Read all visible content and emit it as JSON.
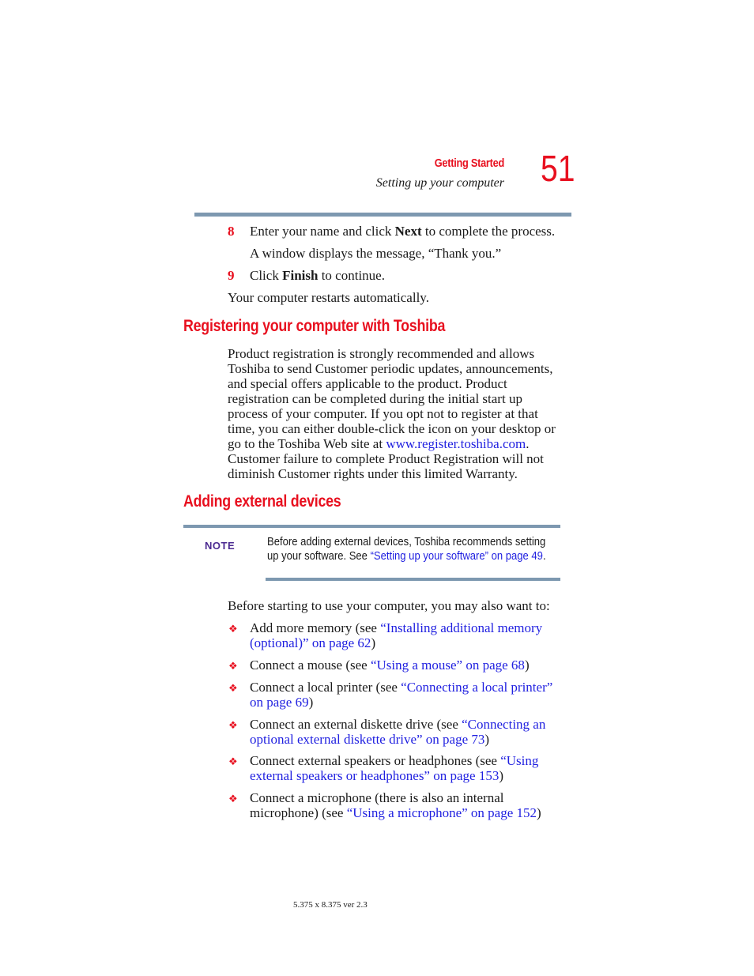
{
  "header": {
    "section": "Getting Started",
    "subsection": "Setting up your computer",
    "page_number": "51"
  },
  "steps": [
    {
      "number": "8",
      "before": "Enter your name and click ",
      "bold": "Next",
      "after": " to complete the process."
    },
    {
      "number": "",
      "text": "A window displays the message, “Thank you.”"
    },
    {
      "number": "9",
      "before": "Click ",
      "bold": "Finish",
      "after": " to continue."
    }
  ],
  "restart_text": "Your computer restarts automatically.",
  "registering": {
    "heading": "Registering your computer with Toshiba",
    "lines": [
      "Product registration is strongly recommended and allows",
      "Toshiba to send Customer periodic updates, announcements,",
      "and special offers applicable to the product. Product",
      "registration can be completed during the initial start up",
      "process of your computer. If you opt not to register at that",
      "time, you can either double-click the icon on your desktop or"
    ],
    "line7_before": "go to the Toshiba Web site at ",
    "link": "www.register.toshiba.com",
    "line7_after": ".",
    "lines_end": [
      "Customer failure to complete Product Registration will not",
      "diminish Customer rights under this limited Warranty."
    ]
  },
  "adding": {
    "heading": "Adding external devices",
    "note_label": "NOTE",
    "note_line1": "Before adding external devices, Toshiba recommends setting",
    "note_line2_before": "up your software. See ",
    "note_link": "“Setting up your software” on page 49",
    "note_line2_after": ".",
    "intro": "Before starting to use your computer, you may also want to:",
    "bullets": [
      {
        "l1_text": "Add more memory (see ",
        "l1_link": "“Installing additional memory",
        "l2_link": "(optional)” on page 62",
        "l2_text": ")"
      },
      {
        "l1_text": "Connect a mouse (see ",
        "l1_link": "“Using a mouse” on page 68",
        "l1_after": ")"
      },
      {
        "l1_text": "Connect a local printer (see ",
        "l1_link": "“Connecting a local printer”",
        "l2_link": "on page 69",
        "l2_text": ")"
      },
      {
        "l1_text": "Connect an external diskette drive (see ",
        "l1_link": "“Connecting an",
        "l2_link": "optional external diskette drive” on page 73",
        "l2_text": ")"
      },
      {
        "l1_text": "Connect external speakers or headphones (see ",
        "l1_link": "“Using",
        "l2_link": "external speakers or headphones” on page 153",
        "l2_text": ")"
      },
      {
        "l1_text": "Connect a microphone (there is also an internal",
        "l2_pre": "microphone) (see ",
        "l2_link": "“Using a microphone” on page 152",
        "l2_text": ")"
      }
    ],
    "bullet_icon": "❖"
  },
  "footer": "5.375 x 8.375 ver 2.3"
}
